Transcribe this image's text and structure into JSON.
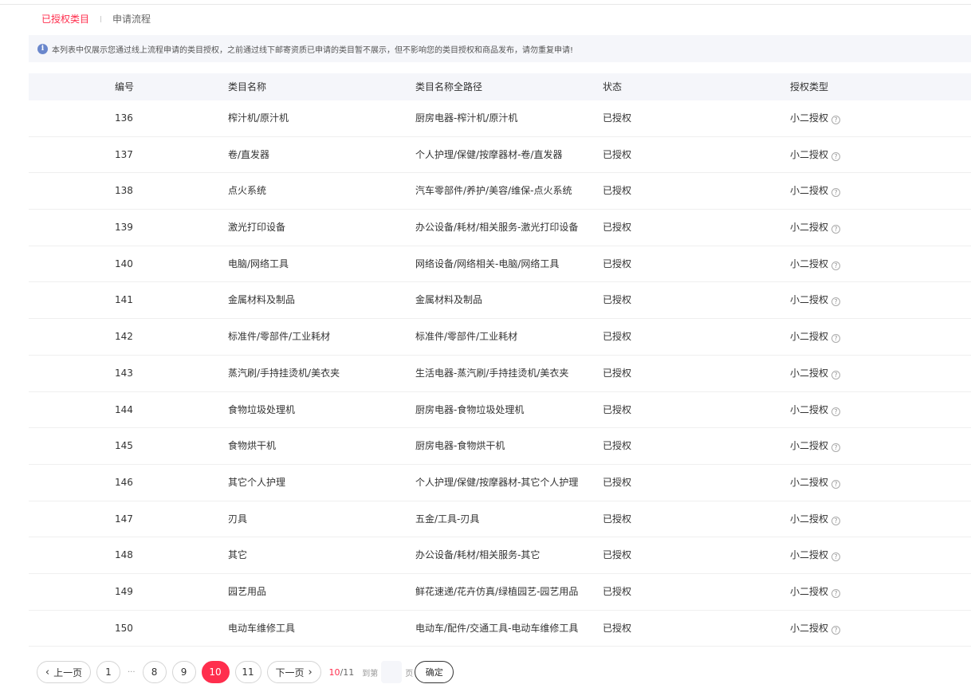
{
  "tabs": [
    {
      "label": "已授权类目",
      "active": true
    },
    {
      "label": "申请流程",
      "active": false
    }
  ],
  "notice": {
    "icon": "info-icon",
    "text": "本列表中仅展示您通过线上流程申请的类目授权，之前通过线下邮寄资质已申请的类目暂不展示，但不影响您的类目授权和商品发布，请勿重复申请!"
  },
  "table": {
    "headers": [
      "编号",
      "类目名称",
      "类目名称全路径",
      "状态",
      "授权类型"
    ],
    "rows": [
      {
        "id": "136",
        "name": "榨汁机/原汁机",
        "path": "厨房电器-榨汁机/原汁机",
        "status": "已授权",
        "type": "小二授权"
      },
      {
        "id": "137",
        "name": "卷/直发器",
        "path": "个人护理/保健/按摩器材-卷/直发器",
        "status": "已授权",
        "type": "小二授权"
      },
      {
        "id": "138",
        "name": "点火系统",
        "path": "汽车零部件/养护/美容/维保-点火系统",
        "status": "已授权",
        "type": "小二授权"
      },
      {
        "id": "139",
        "name": "激光打印设备",
        "path": "办公设备/耗材/相关服务-激光打印设备",
        "status": "已授权",
        "type": "小二授权"
      },
      {
        "id": "140",
        "name": "电脑/网络工具",
        "path": "网络设备/网络相关-电脑/网络工具",
        "status": "已授权",
        "type": "小二授权"
      },
      {
        "id": "141",
        "name": "金属材料及制品",
        "path": "金属材料及制品",
        "status": "已授权",
        "type": "小二授权"
      },
      {
        "id": "142",
        "name": "标准件/零部件/工业耗材",
        "path": "标准件/零部件/工业耗材",
        "status": "已授权",
        "type": "小二授权"
      },
      {
        "id": "143",
        "name": "蒸汽刷/手持挂烫机/美衣夹",
        "path": "生活电器-蒸汽刷/手持挂烫机/美衣夹",
        "status": "已授权",
        "type": "小二授权"
      },
      {
        "id": "144",
        "name": "食物垃圾处理机",
        "path": "厨房电器-食物垃圾处理机",
        "status": "已授权",
        "type": "小二授权"
      },
      {
        "id": "145",
        "name": "食物烘干机",
        "path": "厨房电器-食物烘干机",
        "status": "已授权",
        "type": "小二授权"
      },
      {
        "id": "146",
        "name": "其它个人护理",
        "path": "个人护理/保健/按摩器材-其它个人护理",
        "status": "已授权",
        "type": "小二授权"
      },
      {
        "id": "147",
        "name": "刃具",
        "path": "五金/工具-刃具",
        "status": "已授权",
        "type": "小二授权"
      },
      {
        "id": "148",
        "name": "其它",
        "path": "办公设备/耗材/相关服务-其它",
        "status": "已授权",
        "type": "小二授权"
      },
      {
        "id": "149",
        "name": "园艺用品",
        "path": "鲜花速递/花卉仿真/绿植园艺-园艺用品",
        "status": "已授权",
        "type": "小二授权"
      },
      {
        "id": "150",
        "name": "电动车维修工具",
        "path": "电动车/配件/交通工具-电动车维修工具",
        "status": "已授权",
        "type": "小二授权"
      }
    ],
    "help_icon": "question-circle-icon",
    "help_glyph": "?"
  },
  "pagination": {
    "prev_label": "上一页",
    "next_label": "下一页",
    "prev_icon": "chevron-left-icon",
    "next_icon": "chevron-right-icon",
    "prev_glyph": "‹",
    "next_glyph": "›",
    "first_page": "1",
    "ellipsis": "···",
    "pages": [
      "8",
      "9",
      "10",
      "11"
    ],
    "current_page": "10",
    "current": "10",
    "total_suffix": "/11",
    "goto_label": "到第",
    "goto_value": "",
    "goto_suffix": "页",
    "confirm_label": "确定"
  },
  "colors": {
    "accent": "#ff2e4d",
    "header_bg": "#f5f6fa",
    "info_icon": "#6a87cc"
  }
}
